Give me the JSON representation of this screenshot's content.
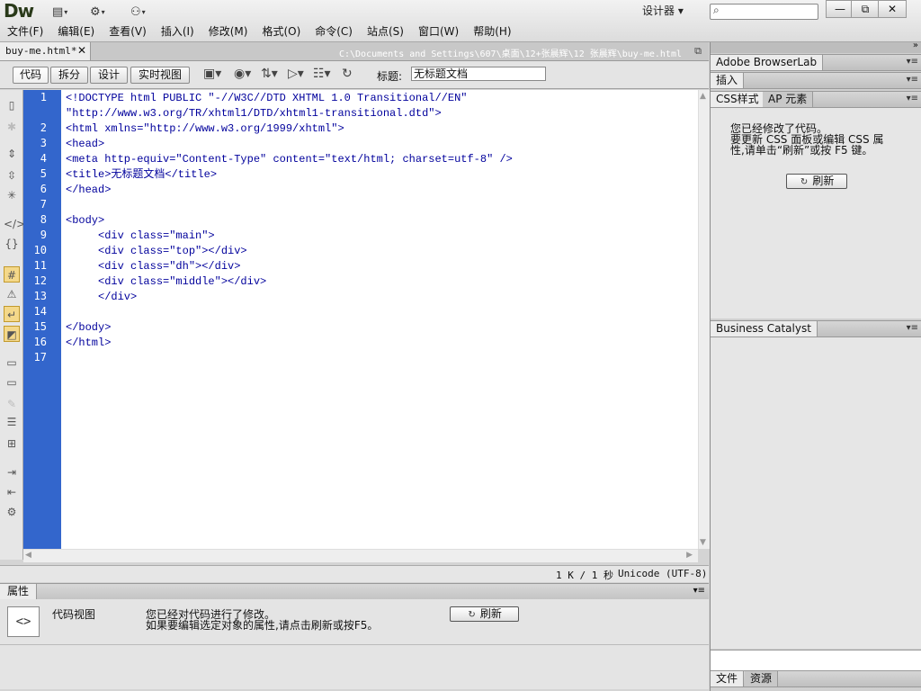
{
  "app": {
    "logo": "Dw",
    "designer_label": "设计器 ▾",
    "search_placeholder": ""
  },
  "menu": [
    "文件(F)",
    "编辑(E)",
    "查看(V)",
    "插入(I)",
    "修改(M)",
    "格式(O)",
    "命令(C)",
    "站点(S)",
    "窗口(W)",
    "帮助(H)"
  ],
  "window_buttons": {
    "minimize": "—",
    "maximize": "⧉",
    "close": "✕"
  },
  "document": {
    "tab_name": "buy-me.html*",
    "path": "C:\\Documents and Settings\\607\\桌面\\12+张晨辉\\12 张晨辉\\buy-me.html",
    "view_buttons": [
      "代码",
      "拆分",
      "设计",
      "实时视图"
    ],
    "title_label": "标题:",
    "title_value": "无标题文档"
  },
  "code_lines": [
    {
      "n": "1",
      "text": "<!DOCTYPE html PUBLIC \"-//W3C//DTD XHTML 1.0 Transitional//EN\""
    },
    {
      "n": "",
      "text": "\"http://www.w3.org/TR/xhtml1/DTD/xhtml1-transitional.dtd\">"
    },
    {
      "n": "2",
      "text": "<html xmlns=\"http://www.w3.org/1999/xhtml\">"
    },
    {
      "n": "3",
      "text": "<head>"
    },
    {
      "n": "4",
      "text": "<meta http-equiv=\"Content-Type\" content=\"text/html; charset=utf-8\" />"
    },
    {
      "n": "5",
      "text": "<title>无标题文档</title>"
    },
    {
      "n": "6",
      "text": "</head>"
    },
    {
      "n": "7",
      "text": ""
    },
    {
      "n": "8",
      "text": "<body>"
    },
    {
      "n": "9",
      "text": "     <div class=\"main\">"
    },
    {
      "n": "10",
      "text": "     <div class=\"top\"></div>"
    },
    {
      "n": "11",
      "text": "     <div class=\"dh\"></div>"
    },
    {
      "n": "12",
      "text": "     <div class=\"middle\"></div>"
    },
    {
      "n": "13",
      "text": "     </div>"
    },
    {
      "n": "14",
      "text": ""
    },
    {
      "n": "15",
      "text": "</body>"
    },
    {
      "n": "16",
      "text": "</html>"
    },
    {
      "n": "17",
      "text": ""
    }
  ],
  "status": {
    "size": "1 K / 1 秒",
    "encoding": "Unicode (UTF-8)"
  },
  "properties": {
    "tab": "属性",
    "icon": "<>",
    "view": "代码视图",
    "message_line1": "您已经对代码进行了修改。",
    "message_line2": "如果要编辑选定对象的属性,请点击刷新或按F5。",
    "refresh": "刷新"
  },
  "panels": {
    "browserlab": "Adobe BrowserLab",
    "insert": "插入",
    "css_tab": "CSS样式",
    "ap_tab": "AP 元素",
    "css_message": [
      "您已经修改了代码。",
      "要更新 CSS 面板或编辑 CSS 属",
      "性,请单击“刷新”或按 F5 键。"
    ],
    "css_refresh": "刷新",
    "business": "Business Catalyst",
    "files_tab": "文件",
    "assets_tab": "资源"
  }
}
